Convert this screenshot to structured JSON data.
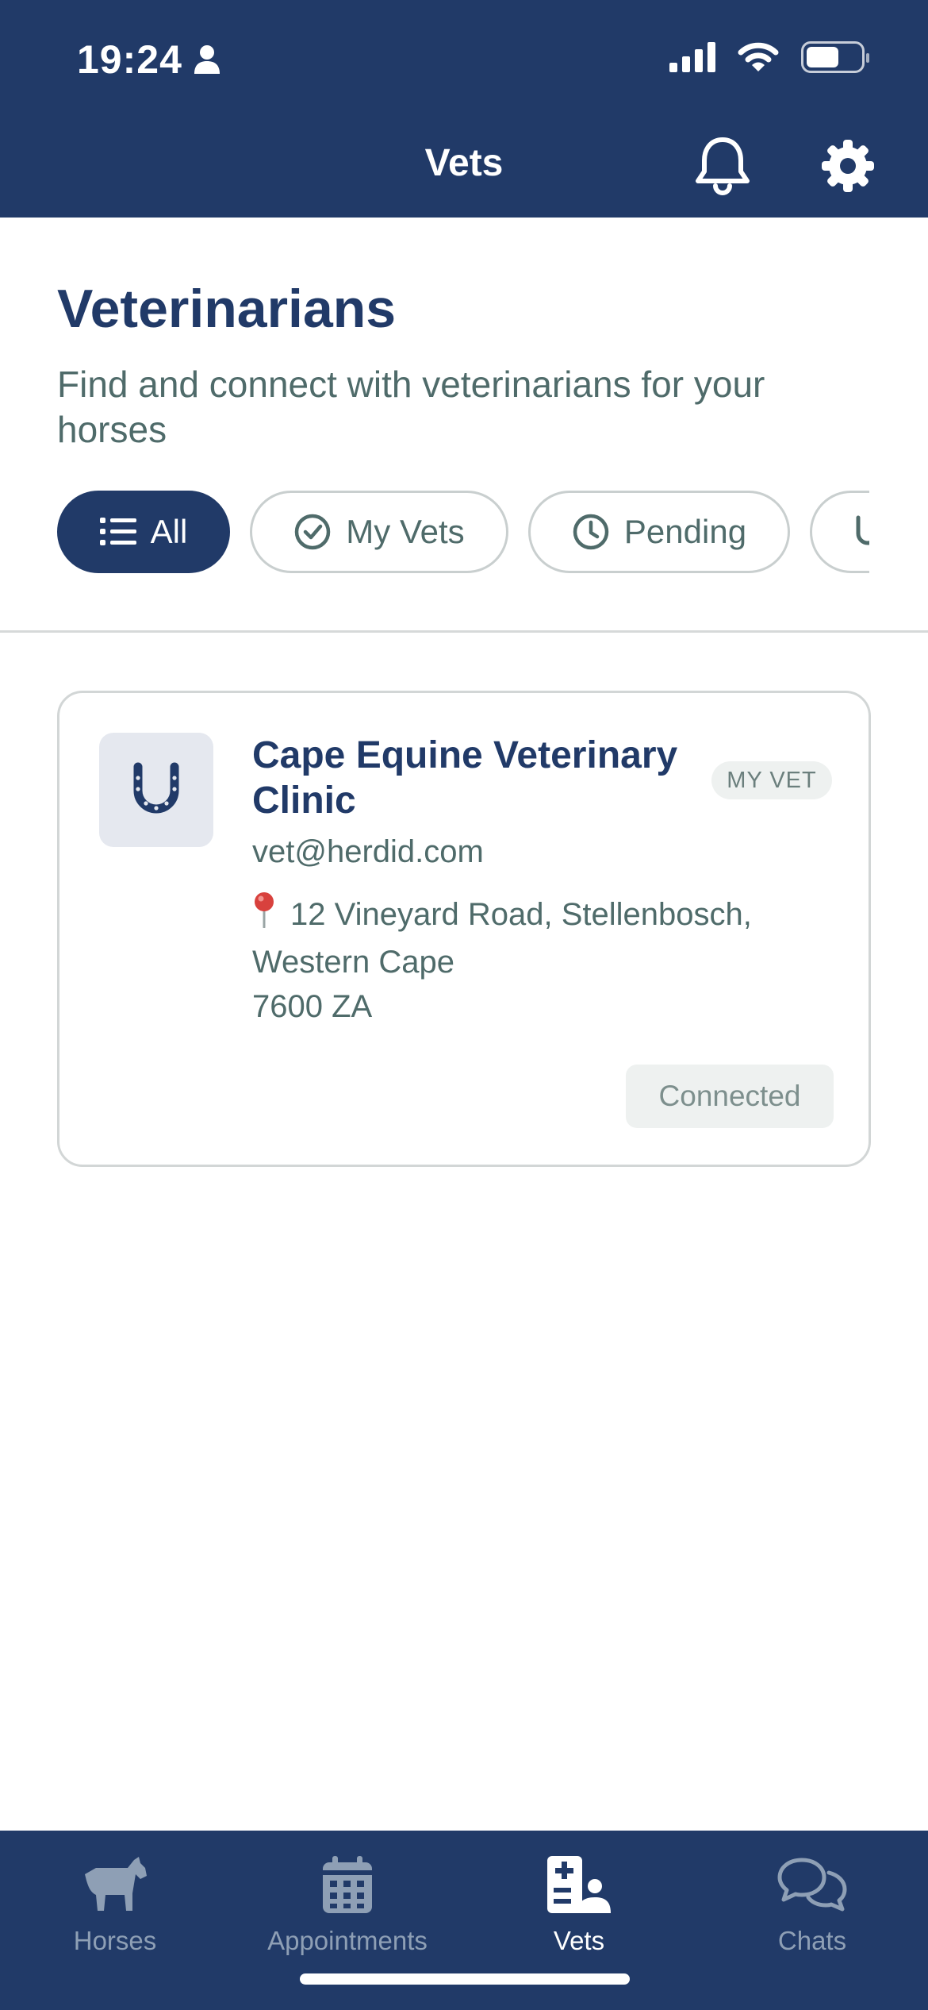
{
  "status_bar": {
    "time": "19:24"
  },
  "nav": {
    "title": "Vets"
  },
  "page": {
    "title": "Veterinarians",
    "subtitle": "Find and connect with veterinarians for your horses"
  },
  "filters": [
    {
      "label": "All",
      "icon": "list-icon",
      "active": true
    },
    {
      "label": "My Vets",
      "icon": "check-circle-icon",
      "active": false
    },
    {
      "label": "Pending",
      "icon": "clock-icon",
      "active": false
    }
  ],
  "vets": [
    {
      "name": "Cape Equine Veterinary Clinic",
      "badge": "MY VET",
      "email": "vet@herdid.com",
      "address_line1": "12 Vineyard Road, Stellenbosch, Western Cape",
      "address_line2": "7600 ZA",
      "status": "Connected",
      "icon": "horseshoe-icon"
    }
  ],
  "tabs": [
    {
      "label": "Horses",
      "icon": "horse-icon",
      "active": false
    },
    {
      "label": "Appointments",
      "icon": "calendar-icon",
      "active": false
    },
    {
      "label": "Vets",
      "icon": "vet-icon",
      "active": true
    },
    {
      "label": "Chats",
      "icon": "chat-icon",
      "active": false
    }
  ],
  "colors": {
    "primary": "#213a68",
    "text_secondary": "#4f6b6a",
    "border": "#d2d6d6",
    "tab_inactive": "#8e9fb5",
    "pin": "#d8413d"
  }
}
